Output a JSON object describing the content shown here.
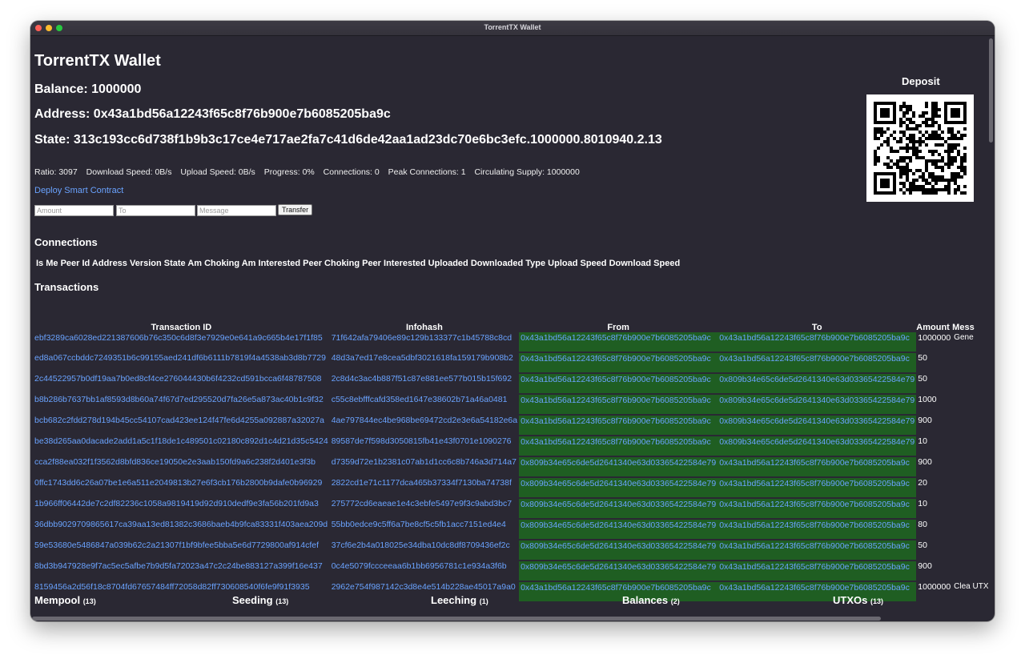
{
  "window": {
    "title": "TorrentTX Wallet"
  },
  "app_title": "TorrentTX Wallet",
  "balance_line": "Balance: 1000000",
  "address_line": "Address: 0x43a1bd56a12243f65c8f76b900e7b6085205ba9c",
  "state_line": "State: 313c193cc6d738f1b9b3c17ce4e717ae2fa7c41d6de42aa1ad23dc70e6bc3efc.1000000.8010940.2.13",
  "stats": [
    "Ratio: 3097",
    "Download Speed: 0B/s",
    "Upload Speed: 0B/s",
    "Progress: 0%",
    "Connections: 0",
    "Peak Connections: 1",
    "Circulating Supply: 1000000"
  ],
  "deploy_link": "Deploy Smart Contract",
  "transfer_form": {
    "amount_placeholder": "Amount",
    "to_placeholder": "To",
    "message_placeholder": "Message",
    "button_label": "Transfer"
  },
  "deposit": {
    "title": "Deposit",
    "qr_icon": "qr-code-icon"
  },
  "connections": {
    "title": "Connections",
    "headers_text": "Is Me Peer Id Address Version State Am Choking Am Interested Peer Choking Peer Interested Uploaded Downloaded Type Upload Speed Download Speed"
  },
  "transactions": {
    "title": "Transactions",
    "headers": [
      "Transaction ID",
      "Infohash",
      "From",
      "To",
      "Amount",
      "Mess"
    ],
    "rows": [
      {
        "id": "ebf3289ca6028ed221387606b76c350c6d8f3e7929e0e641a9c665b4e17f1f85",
        "infohash": "71f642afa79406e89c129b133377c1b45788c8cd",
        "from": "0x43a1bd56a12243f65c8f76b900e7b6085205ba9c",
        "to": "0x43a1bd56a12243f65c8f76b900e7b6085205ba9c",
        "amount": "1000000",
        "message": "Gene"
      },
      {
        "id": "ed8a067ccbddc7249351b6c99155aed241df6b6111b7819f4a4538ab3d8b7729",
        "infohash": "48d3a7ed17e8cea5dbf3021618fa159179b908b2",
        "from": "0x43a1bd56a12243f65c8f76b900e7b6085205ba9c",
        "to": "0x43a1bd56a12243f65c8f76b900e7b6085205ba9c",
        "amount": "50",
        "message": ""
      },
      {
        "id": "2c44522957b0df19aa7b0ed8cf4ce276044430b6f4232cd591bcca6f48787508",
        "infohash": "2c8d4c3ac4b887f51c87e881ee577b015b15f692",
        "from": "0x43a1bd56a12243f65c8f76b900e7b6085205ba9c",
        "to": "0x809b34e65c6de5d2641340e63d03365422584e79",
        "amount": "50",
        "message": ""
      },
      {
        "id": "b8b286b7637bb1af8593d8b60a74f67d7ed295520d7fa26e5a873ac40b1c9f32",
        "infohash": "c55c8ebfffcafd358ed1647e38602b71a46a0481",
        "from": "0x43a1bd56a12243f65c8f76b900e7b6085205ba9c",
        "to": "0x809b34e65c6de5d2641340e63d03365422584e79",
        "amount": "1000",
        "message": ""
      },
      {
        "id": "bcb682c2fdd278d194b45cc54107cad423ee124f47fe6d4255a092887a32027a",
        "infohash": "4ae797844ec4be968be69472cd2e3e6a54182e6a",
        "from": "0x43a1bd56a12243f65c8f76b900e7b6085205ba9c",
        "to": "0x809b34e65c6de5d2641340e63d03365422584e79",
        "amount": "900",
        "message": ""
      },
      {
        "id": "be38d265aa0dacade2add1a5c1f18de1c489501c02180c892d1c4d21d35c5424",
        "infohash": "89587de7f598d3050815fb41e43f0701e1090276",
        "from": "0x43a1bd56a12243f65c8f76b900e7b6085205ba9c",
        "to": "0x809b34e65c6de5d2641340e63d03365422584e79",
        "amount": "10",
        "message": ""
      },
      {
        "id": "cca2f88ea032f1f3562d8bfd836ce19050e2e3aab150fd9a6c238f2d401e3f3b",
        "infohash": "d7359d72e1b2381c07ab1d1cc6c8b746a3d714a7",
        "from": "0x809b34e65c6de5d2641340e63d03365422584e79",
        "to": "0x43a1bd56a12243f65c8f76b900e7b6085205ba9c",
        "amount": "900",
        "message": ""
      },
      {
        "id": "0ffc1743dd6c26a07be1e6a511e2049813b27e6f3cb176b2800b9dafe0b96929",
        "infohash": "2822cd1e71c1177dca465b37334f7130ba74738f",
        "from": "0x809b34e65c6de5d2641340e63d03365422584e79",
        "to": "0x43a1bd56a12243f65c8f76b900e7b6085205ba9c",
        "amount": "20",
        "message": ""
      },
      {
        "id": "1b966ff06442de7c2df82236c1058a9819419d92d910dedf9e3fa56b201fd9a3",
        "infohash": "275772cd6eaeae1e4c3ebfe5497e9f3c9abd3bc7",
        "from": "0x809b34e65c6de5d2641340e63d03365422584e79",
        "to": "0x43a1bd56a12243f65c8f76b900e7b6085205ba9c",
        "amount": "10",
        "message": ""
      },
      {
        "id": "36dbb9029709865617ca39aa13ed81382c3686baeb4b9fca83331f403aea209d",
        "infohash": "55bb0edce9c5ff6a7be8cf5c5fb1acc7151ed4e4",
        "from": "0x809b34e65c6de5d2641340e63d03365422584e79",
        "to": "0x43a1bd56a12243f65c8f76b900e7b6085205ba9c",
        "amount": "80",
        "message": ""
      },
      {
        "id": "59e53680e5486847a039b62c2a21307f1bf9bfee5bba5e6d7729800af914cfef",
        "infohash": "37cf6e2b4a018025e34dba10dc8df8709436ef2c",
        "from": "0x809b34e65c6de5d2641340e63d03365422584e79",
        "to": "0x43a1bd56a12243f65c8f76b900e7b6085205ba9c",
        "amount": "50",
        "message": ""
      },
      {
        "id": "8bd3b947928e9f7ac5ec5afbe7b9d5fa72023a47c2c24be883127a399f16e437",
        "infohash": "0c4e5079fccceeaa6b1bb6956781c1e934a3f6b",
        "from": "0x809b34e65c6de5d2641340e63d03365422584e79",
        "to": "0x43a1bd56a12243f65c8f76b900e7b6085205ba9c",
        "amount": "900",
        "message": ""
      },
      {
        "id": "8159456a2d56f18c8704fd67657484ff72058d82ff730608540f6fe9f91f3935",
        "infohash": "2962e754f987142c3d8e4e514b228ae45017a9a0",
        "from": "0x43a1bd56a12243f65c8f76b900e7b6085205ba9c",
        "to": "0x43a1bd56a12243f65c8f76b900e7b6085205ba9c",
        "amount": "1000000",
        "message": "Clea UTX"
      }
    ]
  },
  "tabs": [
    {
      "label": "Mempool",
      "count": "(13)"
    },
    {
      "label": "Seeding",
      "count": "(13)"
    },
    {
      "label": "Leeching",
      "count": "(1)"
    },
    {
      "label": "Balances",
      "count": "(2)"
    },
    {
      "label": "UTXOs",
      "count": "(13)"
    }
  ],
  "colors": {
    "bg": "#2a2833",
    "link": "#6aa3ff",
    "highlight": "#1f5e22"
  }
}
